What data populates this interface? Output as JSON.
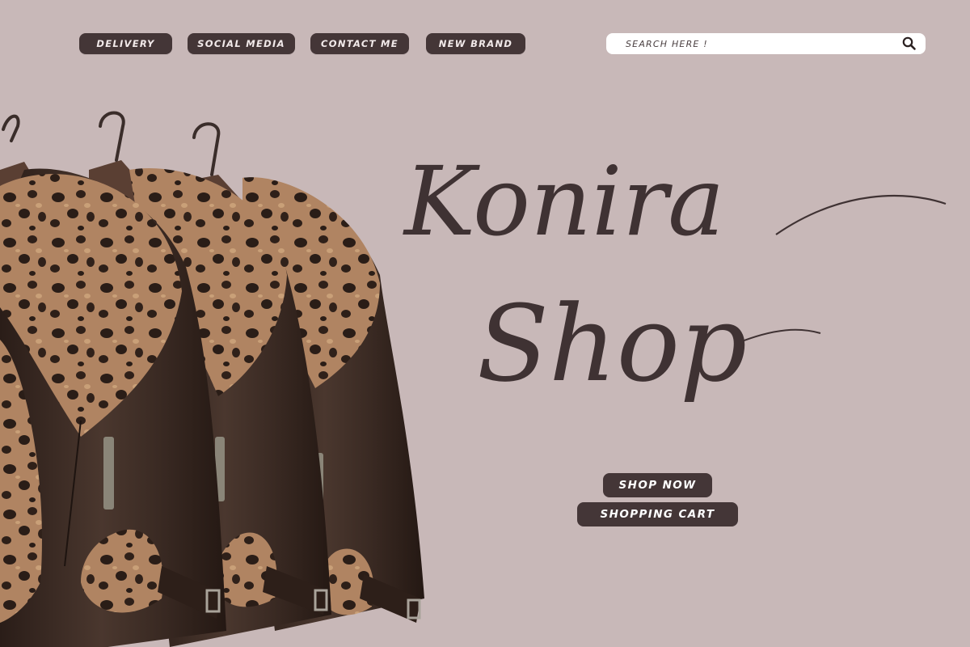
{
  "nav": {
    "items": [
      {
        "label": "DELIVERY"
      },
      {
        "label": "SOCIAL MEDIA"
      },
      {
        "label": "CONTACT ME"
      },
      {
        "label": "NEW BRAND"
      }
    ]
  },
  "search": {
    "placeholder": "SEARCH HERE !",
    "value": "",
    "icon": "search-icon"
  },
  "brand": {
    "line1": "Konira",
    "line2": "Shop"
  },
  "cta": {
    "shop_now": "SHOP NOW",
    "shopping_cart": "SHOPPING CART"
  },
  "colors": {
    "background": "#c8b8b8",
    "accent": "#443637",
    "text_light": "#ffffff"
  }
}
